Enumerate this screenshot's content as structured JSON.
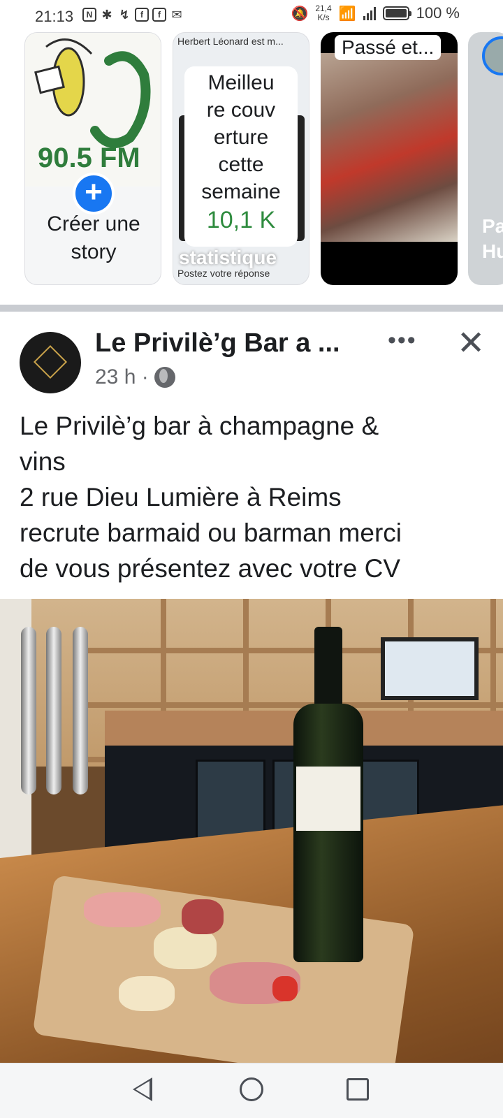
{
  "status_bar": {
    "time": "21:13",
    "net_speed": "21,4\nK/s",
    "battery_pct": "100 %",
    "battery_level": 1.0,
    "icons": [
      "nfc-icon",
      "bluetooth-icon",
      "missed-call-icon",
      "facebook-icon",
      "facebook-icon",
      "messenger-icon",
      "mute-icon",
      "wifi-icon",
      "signal-icon",
      "battery-icon"
    ]
  },
  "stories": {
    "create_label": "Créer une\nstory",
    "story2": {
      "top_text": "Herbert Léonard est m...",
      "card_text": "Meilleu\nre couv\nerture\ncette\nsemaine",
      "card_value": "10,1 K",
      "stat_label": "statistique",
      "bottom_text": "Postez votre réponse"
    },
    "story3": {
      "title": "Passé et..."
    },
    "story4": {
      "text": "Pa\nHu"
    }
  },
  "post": {
    "page_name": "Le Privilè’g Bar a ...",
    "time": "23 h ·",
    "text": "Le Privilè’g bar à champagne &\nvins\n2 rue Dieu Lumière à Reims\nrecrute barmaid ou barman merci\nde vous présentez avec votre CV",
    "more_label": "•••",
    "close_label": "✕"
  },
  "colors": {
    "accent": "#1877f2",
    "stat_green": "#2e8b3e",
    "text": "#1c1e21",
    "secondary_text": "#65676b"
  }
}
